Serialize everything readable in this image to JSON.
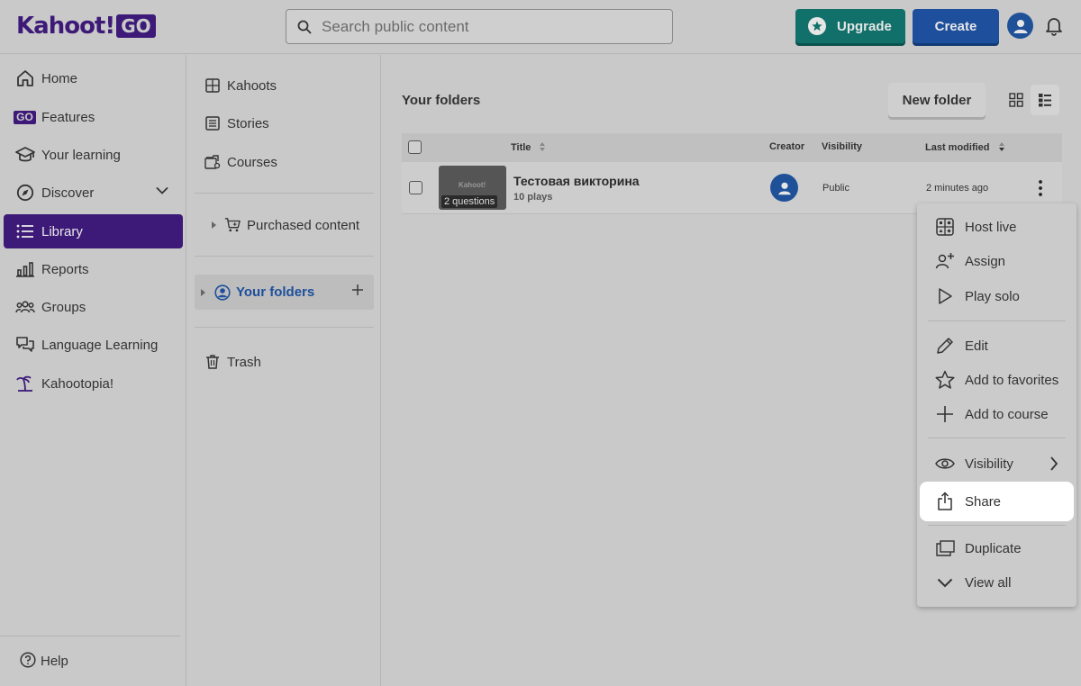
{
  "brand": {
    "logo_main": "Kahoot!",
    "logo_suffix": "GO"
  },
  "search": {
    "placeholder": "Search public content"
  },
  "topbar": {
    "upgrade_label": "Upgrade",
    "create_label": "Create"
  },
  "sidebar": {
    "items": [
      {
        "label": "Home",
        "icon": "home-icon"
      },
      {
        "label": "Features",
        "icon": "go-icon"
      },
      {
        "label": "Your learning",
        "icon": "graduation-cap-icon"
      },
      {
        "label": "Discover",
        "icon": "compass-icon"
      },
      {
        "label": "Library",
        "icon": "list-icon",
        "active": true
      },
      {
        "label": "Reports",
        "icon": "bar-chart-icon"
      },
      {
        "label": "Groups",
        "icon": "group-icon"
      },
      {
        "label": "Language Learning",
        "icon": "language-icon"
      },
      {
        "label": "Kahootopia!",
        "icon": "island-icon"
      }
    ],
    "help_label": "Help"
  },
  "library_nav": {
    "kahoots": "Kahoots",
    "stories": "Stories",
    "courses": "Courses",
    "purchased": "Purchased content",
    "your_folders": "Your folders",
    "trash": "Trash"
  },
  "main": {
    "title": "Your folders",
    "new_folder_label": "New folder",
    "columns": {
      "title": "Title",
      "creator": "Creator",
      "visibility": "Visibility",
      "last_modified": "Last modified"
    },
    "rows": [
      {
        "title": "Тестовая викторина",
        "plays": "10 plays",
        "questions": "2 questions",
        "thumb_logo": "Kahoot!",
        "visibility": "Public",
        "last_modified": "2 minutes ago"
      }
    ]
  },
  "context_menu": {
    "items": [
      {
        "label": "Host live",
        "icon": "host-live-icon"
      },
      {
        "label": "Assign",
        "icon": "assign-icon"
      },
      {
        "label": "Play solo",
        "icon": "play-icon"
      },
      {
        "label": "Edit",
        "icon": "pencil-icon"
      },
      {
        "label": "Add to favorites",
        "icon": "star-icon"
      },
      {
        "label": "Add to course",
        "icon": "plus-icon"
      },
      {
        "label": "Visibility",
        "icon": "eye-icon"
      },
      {
        "label": "Share",
        "icon": "share-icon",
        "highlighted": true
      },
      {
        "label": "Duplicate",
        "icon": "duplicate-icon"
      },
      {
        "label": "View all",
        "icon": "chevron-down-icon"
      }
    ]
  },
  "colors": {
    "brand_purple": "#3d1a78",
    "upgrade_green": "#11716a",
    "create_blue": "#1d4f9c",
    "highlight": "#ffffff"
  }
}
